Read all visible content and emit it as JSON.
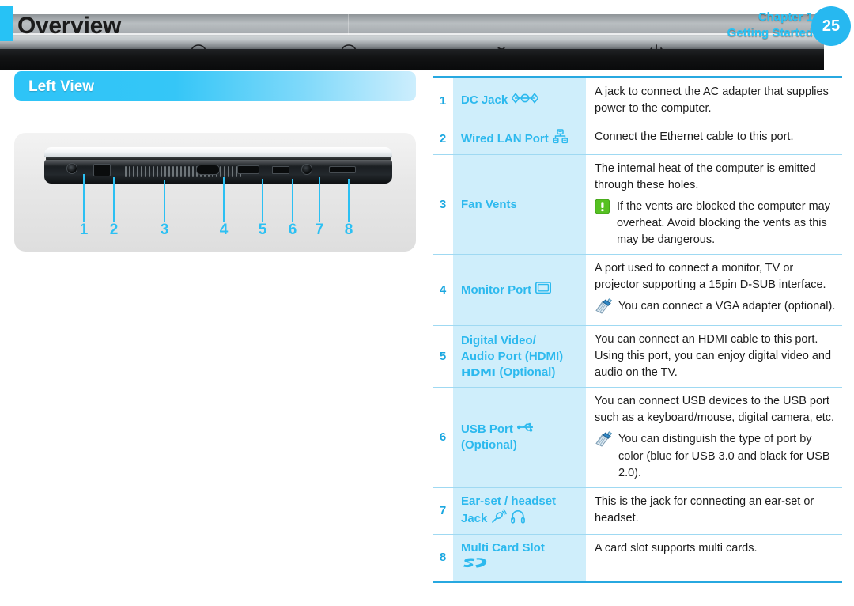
{
  "header": {
    "title": "Overview",
    "chapter_line1": "Chapter 1",
    "chapter_line2": "Getting Started",
    "page_number": "25",
    "accent_color": "#27c2f5",
    "indicator_icons": [
      "led-dot",
      "caps-lock-icon",
      "led-dot",
      "num-lock-icon",
      "led-dot",
      "wireless-icon",
      "led-dot",
      "power-icon"
    ]
  },
  "section": {
    "banner_title": "Left View"
  },
  "figure": {
    "callouts": [
      "1",
      "2",
      "3",
      "4",
      "5",
      "6",
      "7",
      "8"
    ],
    "caption_color": "#2cc0f3"
  },
  "table": {
    "rows": [
      {
        "num": "1",
        "name": "DC Jack",
        "icons": [
          "dc-jack-icon"
        ],
        "desc": "A jack to connect the AC adapter that supplies power to the computer.",
        "notes": []
      },
      {
        "num": "2",
        "name": "Wired LAN Port",
        "icons": [
          "network-icon"
        ],
        "desc": "Connect the Ethernet cable to this port.",
        "notes": []
      },
      {
        "num": "3",
        "name": "Fan Vents",
        "icons": [],
        "desc": "The internal heat of the computer is emitted through these holes.",
        "notes": [
          {
            "type": "warning",
            "text": "If the vents are blocked the computer may overheat. Avoid blocking the vents as this may be dangerous."
          }
        ]
      },
      {
        "num": "4",
        "name": "Monitor Port",
        "icons": [
          "monitor-icon"
        ],
        "desc": "A port used to connect a monitor, TV or projector supporting a 15pin D-SUB interface.",
        "notes": [
          {
            "type": "note",
            "text": "You can connect a VGA adapter (optional)."
          }
        ]
      },
      {
        "num": "5",
        "name": "Digital Video/ Audio Port (HDMI)",
        "name_line1": "Digital Video/",
        "name_line2": "Audio Port (HDMI)",
        "logo": "HDMI",
        "name_suffix": "(Optional)",
        "icons": [
          "hdmi-logo"
        ],
        "desc": "You can connect an HDMI cable to this port. Using this port, you can enjoy digital video and audio on the TV.",
        "notes": []
      },
      {
        "num": "6",
        "name": "USB Port",
        "name_suffix": "(Optional)",
        "icons": [
          "usb-icon"
        ],
        "desc": "You can connect USB devices to the USB port such as a keyboard/mouse, digital camera, etc.",
        "notes": [
          {
            "type": "note",
            "text": "You can distinguish the type of port by color (blue for USB 3.0 and black for USB 2.0)."
          }
        ]
      },
      {
        "num": "7",
        "name": "Ear-set / headset",
        "name_line1": "Ear-set / headset",
        "name_line2": "Jack",
        "icons": [
          "microphone-icon",
          "headphone-icon"
        ],
        "desc": "This is the jack for connecting an ear-set or headset.",
        "notes": []
      },
      {
        "num": "8",
        "name": "Multi Card Slot",
        "icons": [
          "sd-card-icon"
        ],
        "desc": "A card slot supports multi cards.",
        "notes": []
      }
    ]
  },
  "colors": {
    "accent": "#2cb9ee",
    "rule": "#27a8e0",
    "name_cell_bg": "#cfeefb",
    "warning_green": "#56c122"
  }
}
